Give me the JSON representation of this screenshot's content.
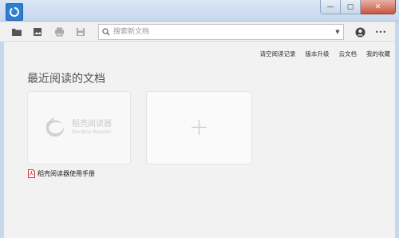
{
  "window": {
    "minimize_glyph": "—",
    "maximize_glyph": "▢",
    "close_glyph": "✕"
  },
  "toolbar": {
    "icons": [
      "open-folder-icon",
      "image-icon",
      "print-icon",
      "save-icon"
    ],
    "search_placeholder": "搜索新文档",
    "dropdown_glyph": "▼",
    "more_glyph": "•••"
  },
  "top_links": [
    "请空阅读记录",
    "版本升级",
    "云文档",
    "我的收藏"
  ],
  "page_title": "最近阅读的文档",
  "doc_card": {
    "logo_cn": "稻壳阅读器",
    "logo_en": "DocBox Reader"
  },
  "add_card": {
    "plus": "+"
  },
  "recent_file": {
    "name": "稻壳阅读器使用手册",
    "icon": "pdf-icon"
  },
  "colors": {
    "accent": "#2d7ed0",
    "pdf_red": "#d32f2f"
  }
}
